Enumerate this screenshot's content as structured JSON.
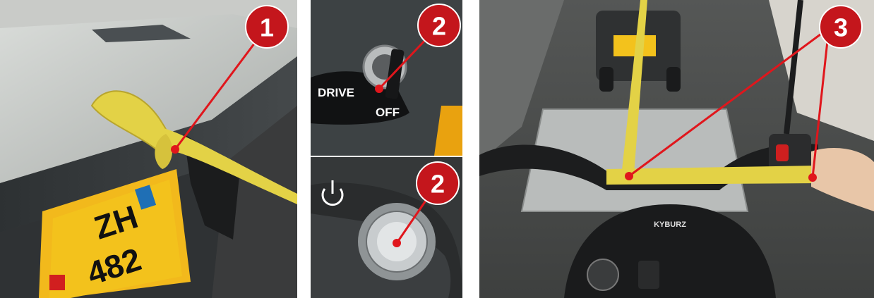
{
  "panels": [
    {
      "id": "panel-1",
      "marker": "1",
      "plate": {
        "canton": "ZH",
        "digits": "482"
      }
    },
    {
      "id": "panel-2-key-switch",
      "marker": "2",
      "switch_labels": {
        "drive": "DRIVE",
        "off": "OFF"
      }
    },
    {
      "id": "panel-2-power-button",
      "marker": "2",
      "icon": "power-icon"
    },
    {
      "id": "panel-3",
      "marker": "3",
      "brand": "KYBURZ"
    }
  ],
  "colors": {
    "marker_fill": "#c4161c",
    "marker_line": "#e0161c",
    "strap_yellow": "#e3d246",
    "plate_yellow": "#f3c21c"
  }
}
